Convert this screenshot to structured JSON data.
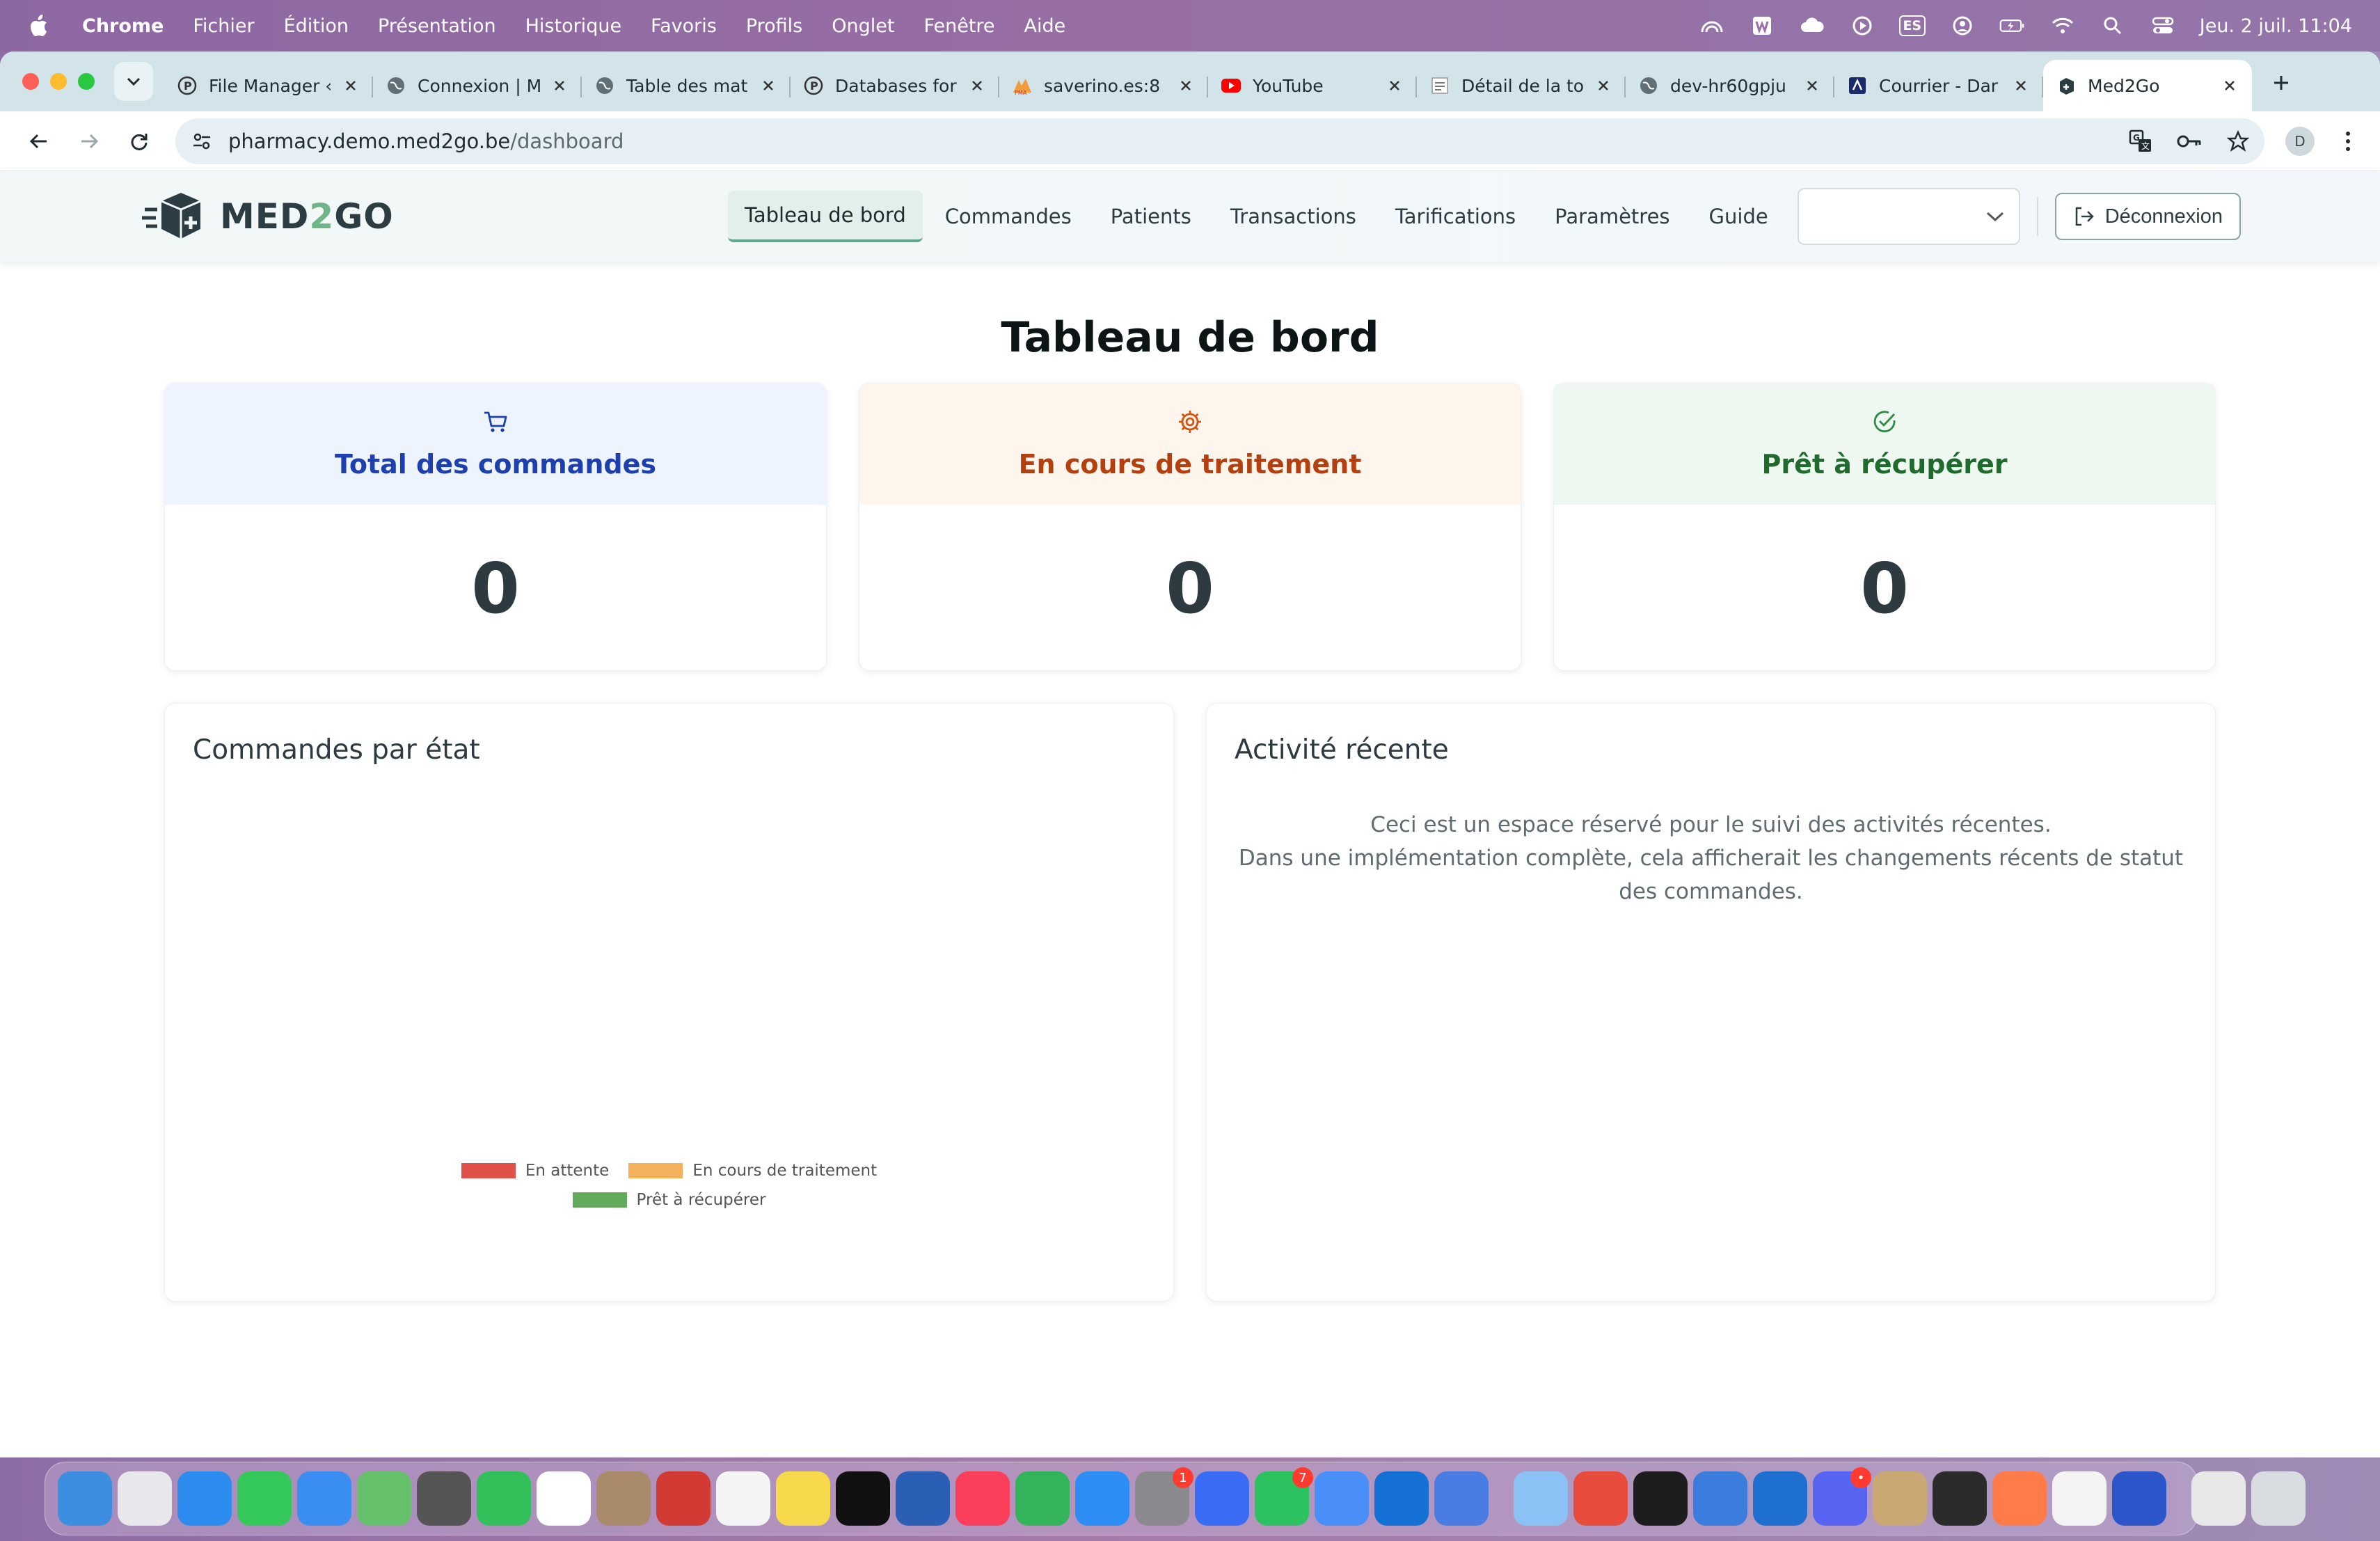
{
  "menubar": {
    "app_name": "Chrome",
    "items": [
      "Fichier",
      "Édition",
      "Présentation",
      "Historique",
      "Favoris",
      "Profils",
      "Onglet",
      "Fenêtre",
      "Aide"
    ],
    "input_source": "ES",
    "clock": "Jeu. 2 juil.  11:04"
  },
  "browser": {
    "tabs": [
      {
        "label": "File Manager ‹",
        "favicon": "p-icon"
      },
      {
        "label": "Connexion | M",
        "favicon": "globe-icon"
      },
      {
        "label": "Table des mat",
        "favicon": "globe-icon"
      },
      {
        "label": "Databases for",
        "favicon": "p-icon"
      },
      {
        "label": "saverino.es:8",
        "favicon": "pma-icon"
      },
      {
        "label": "YouTube",
        "favicon": "youtube-icon"
      },
      {
        "label": "Détail de la to",
        "favicon": "doc-icon"
      },
      {
        "label": "dev-hr60gpju",
        "favicon": "globe-icon"
      },
      {
        "label": "Courrier - Dar",
        "favicon": "mail-icon"
      },
      {
        "label": "Med2Go",
        "favicon": "med2go-icon",
        "active": true
      }
    ],
    "url_host": "pharmacy.demo.med2go.be",
    "url_path": "/dashboard",
    "profile_initial": "D"
  },
  "app": {
    "brand_prefix": "MED",
    "brand_two": "2",
    "brand_suffix": "GO",
    "nav": {
      "dashboard": "Tableau de bord",
      "orders": "Commandes",
      "patients": "Patients",
      "transactions": "Transactions",
      "pricing": "Tarifications",
      "settings": "Paramètres",
      "guide": "Guide"
    },
    "pharmacy_select_value": "",
    "logout": "Déconnexion",
    "page_title": "Tableau de bord",
    "stats": [
      {
        "label": "Total des commandes",
        "value": "0",
        "icon": "cart-icon",
        "color": "#1e3fae",
        "bg": "#eef4fd"
      },
      {
        "label": "En cours de traitement",
        "value": "0",
        "icon": "gear-icon",
        "color": "#b4400f",
        "bg": "#fef6ec"
      },
      {
        "label": "Prêt à récupérer",
        "value": "0",
        "icon": "check-circle-icon",
        "color": "#1f6b2e",
        "bg": "#eef8f0"
      }
    ],
    "chart_panel_title": "Commandes par état",
    "activity_panel_title": "Activité récente",
    "activity_line1": "Ceci est un espace réservé pour le suivi des activités récentes.",
    "activity_line2": "Dans une implémentation complète, cela afficherait les changements récents de statut des commandes."
  },
  "chart_data": {
    "type": "pie",
    "categories": [
      "En attente",
      "En cours de traitement",
      "Prêt à récupérer"
    ],
    "values": [
      0,
      0,
      0
    ],
    "colors": [
      "#e0514a",
      "#f4b15c",
      "#64aa5c"
    ],
    "legend_position": "bottom"
  },
  "dock": {
    "apps": [
      {
        "name": "finder",
        "color": "#3d8de0"
      },
      {
        "name": "launchpad",
        "color": "#e8e8ec"
      },
      {
        "name": "safari",
        "color": "#2d8cf0"
      },
      {
        "name": "messages",
        "color": "#34c759"
      },
      {
        "name": "mail",
        "color": "#3a8ef2"
      },
      {
        "name": "maps",
        "color": "#66c06b"
      },
      {
        "name": "calculator",
        "color": "#555"
      },
      {
        "name": "facetime",
        "color": "#33c05a"
      },
      {
        "name": "calendar",
        "color": "#fff"
      },
      {
        "name": "contacts",
        "color": "#a98a6a"
      },
      {
        "name": "photo-booth",
        "color": "#d23b34"
      },
      {
        "name": "reminders",
        "color": "#f4f4f4"
      },
      {
        "name": "notes",
        "color": "#f7d94c"
      },
      {
        "name": "apple-tv",
        "color": "#111"
      },
      {
        "name": "word",
        "color": "#2b5fb6"
      },
      {
        "name": "music",
        "color": "#fb3f5a"
      },
      {
        "name": "numbers",
        "color": "#33b35a"
      },
      {
        "name": "app-store",
        "color": "#2c8ef4"
      },
      {
        "name": "system-settings",
        "color": "#8a8a8e",
        "badge": "1"
      },
      {
        "name": "messenger",
        "color": "#3b6cf6"
      },
      {
        "name": "whatsapp",
        "color": "#2bc25f",
        "badge": "7"
      },
      {
        "name": "messenger-alt",
        "color": "#4a8ef7"
      },
      {
        "name": "outlook",
        "color": "#1570d6"
      },
      {
        "name": "roblox",
        "color": "#4a7de3"
      },
      {
        "name": "preview",
        "color": "#8cc1f5"
      },
      {
        "name": "wps",
        "color": "#e74c3c"
      },
      {
        "name": "terminal",
        "color": "#1d1d1d"
      },
      {
        "name": "xcode",
        "color": "#3b7ddd"
      },
      {
        "name": "filezilla",
        "color": "#1f6fd1"
      },
      {
        "name": "discord",
        "color": "#5865f2",
        "badge": "•"
      },
      {
        "name": "vlc",
        "color": "#c9a873"
      },
      {
        "name": "activity-monitor",
        "color": "#2b2b2b"
      },
      {
        "name": "sublime",
        "color": "#ff7c4a"
      },
      {
        "name": "chrome",
        "color": "#f3f3f3"
      },
      {
        "name": "nordvpn",
        "color": "#2b55c8"
      },
      {
        "name": "documents",
        "color": "#e8e8e8"
      },
      {
        "name": "trash",
        "color": "#d9dde2"
      }
    ]
  }
}
